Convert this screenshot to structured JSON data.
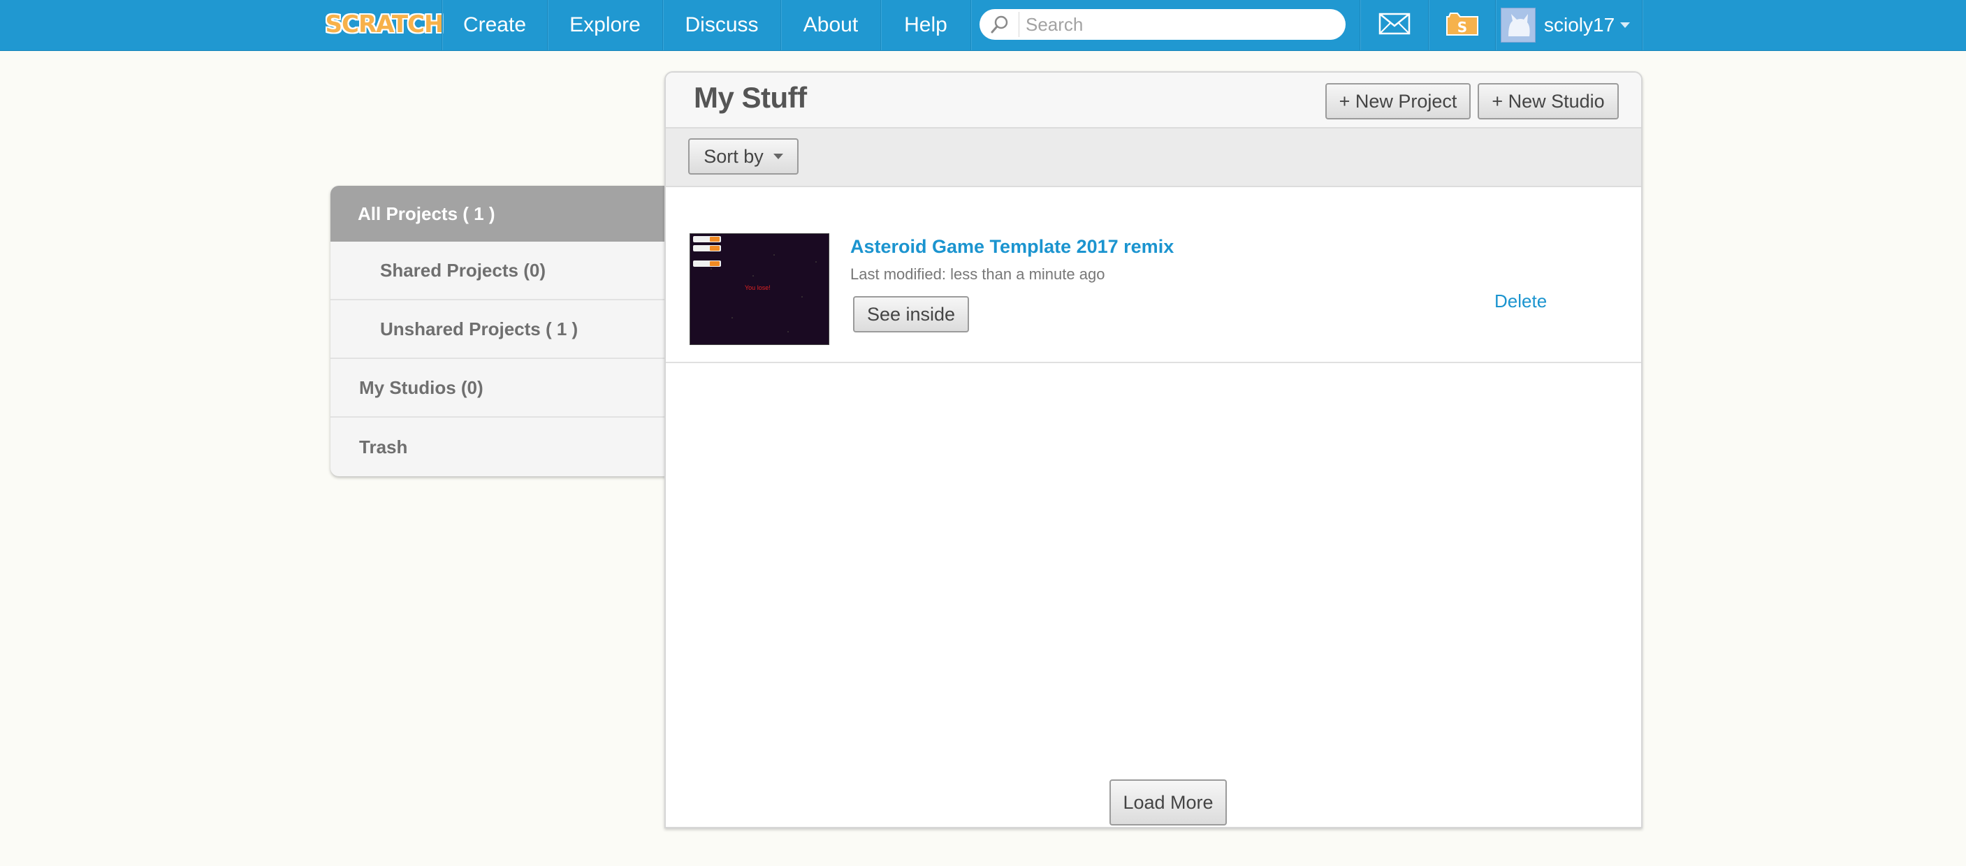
{
  "nav": {
    "logo": "SCRATCH",
    "items": [
      "Create",
      "Explore",
      "Discuss",
      "About",
      "Help"
    ],
    "search_placeholder": "Search",
    "username": "scioly17"
  },
  "page": {
    "title": "My Stuff",
    "new_project": "+ New Project",
    "new_studio": "+ New Studio",
    "sort_by": "Sort by"
  },
  "sidebar": {
    "items": [
      {
        "label": "All Projects ( 1 )",
        "active": true
      },
      {
        "label": "Shared Projects (0)"
      },
      {
        "label": "Unshared Projects ( 1 )"
      },
      {
        "label": "My Studios (0)"
      },
      {
        "label": "Trash"
      }
    ]
  },
  "projects": [
    {
      "title": "Asteroid Game Template 2017 remix",
      "modified": "Last modified: less than a minute ago",
      "see_inside": "See inside",
      "delete": "Delete",
      "thumb_text": "You lose!"
    }
  ],
  "load_more": "Load More",
  "colors": {
    "nav": "#2098d1",
    "link": "#1b94cf",
    "background": "#fbfbf6",
    "sidebar_active": "#a3a3a3"
  }
}
